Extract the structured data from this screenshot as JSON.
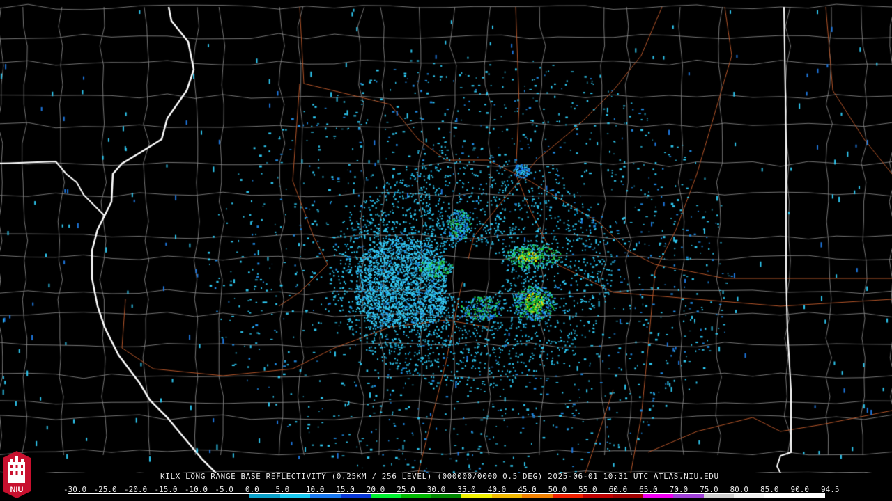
{
  "caption": "KILX LONG RANGE BASE REFLECTIVITY (0.25KM / 256 LEVEL) (000000/0000 0.5 DEG) 2025-06-01 10:31 UTC  ATLAS.NIU.EDU",
  "logo": {
    "text": "NIU",
    "colors": {
      "red": "#c8102e",
      "white": "#ffffff"
    }
  },
  "map": {
    "radar_site": "KILX",
    "product": "Long Range Base Reflectivity",
    "background": "#000000",
    "colors": {
      "county_lines": "#8a8a8a",
      "state_lines": "#ffffff",
      "highways": "#b5562a",
      "light_echo": "#2ec7f0",
      "moderate_echo": "#20d040",
      "strong_echo": "#f0e000"
    }
  },
  "scale": {
    "ticks": [
      "-30.0",
      "-25.0",
      "-20.0",
      "-15.0",
      "-10.0",
      "-5.0",
      "0.0",
      "5.0",
      "10.0",
      "15.0",
      "20.0",
      "25.0",
      "30.0",
      "35.0",
      "40.0",
      "45.0",
      "50.0",
      "55.0",
      "60.0",
      "65.0",
      "70.0",
      "75.0",
      "80.0",
      "85.0",
      "90.0",
      "94.5"
    ],
    "colors": [
      "#000000",
      "#000000",
      "#000000",
      "#000000",
      "#000000",
      "#000000",
      "#0aa0c8",
      "#18c8f0",
      "#1878f0",
      "#0838d8",
      "#00f030",
      "#00b800",
      "#008800",
      "#f0f000",
      "#f0b800",
      "#f08000",
      "#f02000",
      "#c00000",
      "#a00000",
      "#f000f0",
      "#a040d8",
      "#d0d0d0",
      "#f0f0f0",
      "#ffffff",
      "#ffffff"
    ]
  }
}
